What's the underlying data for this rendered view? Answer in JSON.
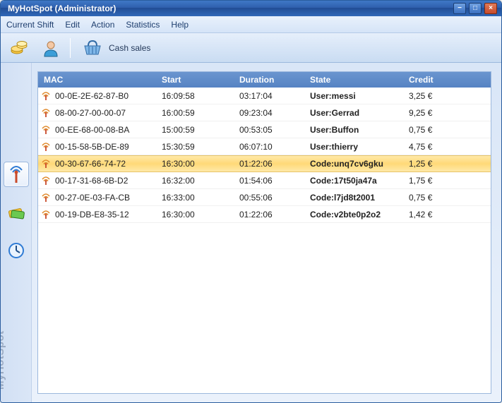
{
  "window": {
    "title": "MyHotSpot  (Administrator)"
  },
  "menu": {
    "items": [
      "Current Shift",
      "Edit",
      "Action",
      "Statistics",
      "Help"
    ]
  },
  "toolbar": {
    "cash_label": "Cash sales"
  },
  "sidebar": {
    "brand": "MyHotSpot"
  },
  "table": {
    "headers": {
      "mac": "MAC",
      "start": "Start",
      "duration": "Duration",
      "state": "State",
      "credit": "Credit"
    },
    "rows": [
      {
        "mac": "00-0E-2E-62-87-B0",
        "start": "16:09:58",
        "duration": "03:17:04",
        "state": "User:messi",
        "credit": "3,25 €",
        "selected": false
      },
      {
        "mac": "08-00-27-00-00-07",
        "start": "16:00:59",
        "duration": "09:23:04",
        "state": "User:Gerrad",
        "credit": "9,25 €",
        "selected": false
      },
      {
        "mac": "00-EE-68-00-08-BA",
        "start": "15:00:59",
        "duration": "00:53:05",
        "state": "User:Buffon",
        "credit": "0,75 €",
        "selected": false
      },
      {
        "mac": "00-15-58-5B-DE-89",
        "start": "15:30:59",
        "duration": "06:07:10",
        "state": "User:thierry",
        "credit": "4,75 €",
        "selected": false
      },
      {
        "mac": "00-30-67-66-74-72",
        "start": "16:30:00",
        "duration": "01:22:06",
        "state": "Code:unq7cv6gku",
        "credit": "1,25 €",
        "selected": true
      },
      {
        "mac": "00-17-31-68-6B-D2",
        "start": "16:32:00",
        "duration": "01:54:06",
        "state": "Code:17t50ja47a",
        "credit": "1,75 €",
        "selected": false
      },
      {
        "mac": "00-27-0E-03-FA-CB",
        "start": "16:33:00",
        "duration": "00:55:06",
        "state": "Code:l7jd8t2001",
        "credit": "0,75 €",
        "selected": false
      },
      {
        "mac": "00-19-DB-E8-35-12",
        "start": "16:30:00",
        "duration": "01:22:06",
        "state": "Code:v2bte0p2o2",
        "credit": "1,42 €",
        "selected": false
      }
    ]
  }
}
